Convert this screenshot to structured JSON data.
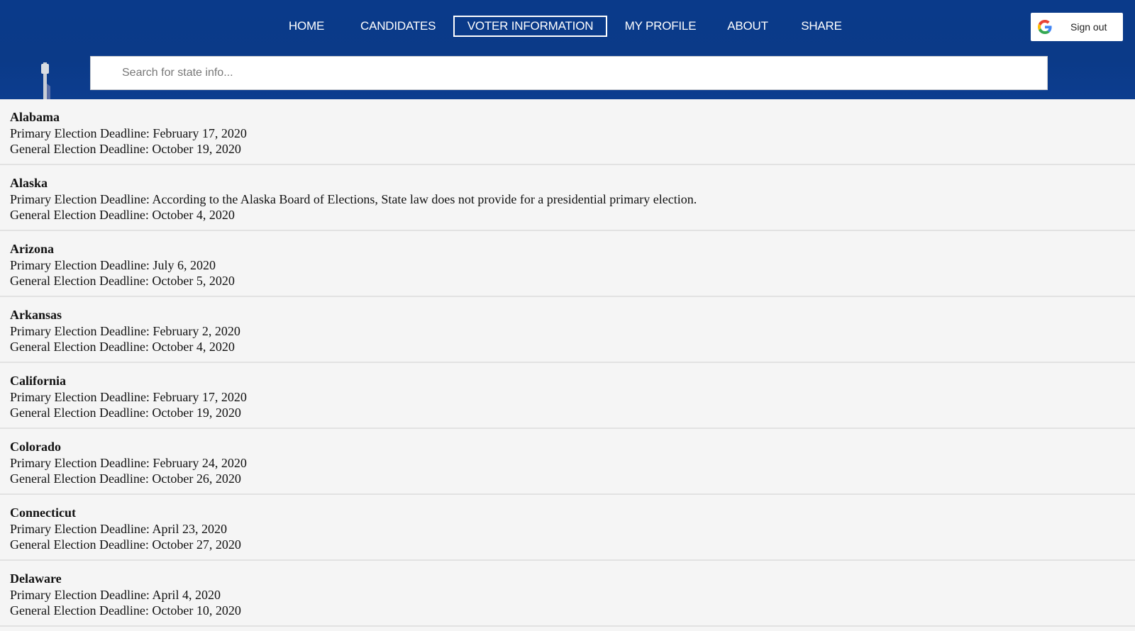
{
  "nav": {
    "items": [
      {
        "label": "HOME"
      },
      {
        "label": "CANDIDATES"
      },
      {
        "label": "VOTER INFORMATION"
      },
      {
        "label": "MY PROFILE"
      },
      {
        "label": "ABOUT"
      },
      {
        "label": "SHARE"
      }
    ],
    "active": "VOTER INFORMATION"
  },
  "auth": {
    "signout_label": "Sign out",
    "icon": "google-g-icon"
  },
  "search": {
    "placeholder": "Search for state info..."
  },
  "states": [
    {
      "name": "Alabama",
      "primary": "Primary Election Deadline: February 17, 2020",
      "general": "General Election Deadline: October 19, 2020"
    },
    {
      "name": "Alaska",
      "primary": "Primary Election Deadline: According to the Alaska Board of Elections, State law does not provide for a presidential primary election.",
      "general": "General Election Deadline: October 4, 2020"
    },
    {
      "name": "Arizona",
      "primary": "Primary Election Deadline: July 6, 2020",
      "general": "General Election Deadline: October 5, 2020"
    },
    {
      "name": "Arkansas",
      "primary": "Primary Election Deadline: February 2, 2020",
      "general": "General Election Deadline: October 4, 2020"
    },
    {
      "name": "California",
      "primary": "Primary Election Deadline: February 17, 2020",
      "general": "General Election Deadline: October 19, 2020"
    },
    {
      "name": "Colorado",
      "primary": "Primary Election Deadline: February 24, 2020",
      "general": "General Election Deadline: October 26, 2020"
    },
    {
      "name": "Connecticut",
      "primary": "Primary Election Deadline: April 23, 2020",
      "general": "General Election Deadline: October 27, 2020"
    },
    {
      "name": "Delaware",
      "primary": "Primary Election Deadline: April 4, 2020",
      "general": "General Election Deadline: October 10, 2020"
    }
  ],
  "colors": {
    "header_bg": "#0b3a88",
    "nav_text": "#ffffff",
    "row_bg": "#f5f5f5",
    "row_divider": "#e2e2e2"
  }
}
